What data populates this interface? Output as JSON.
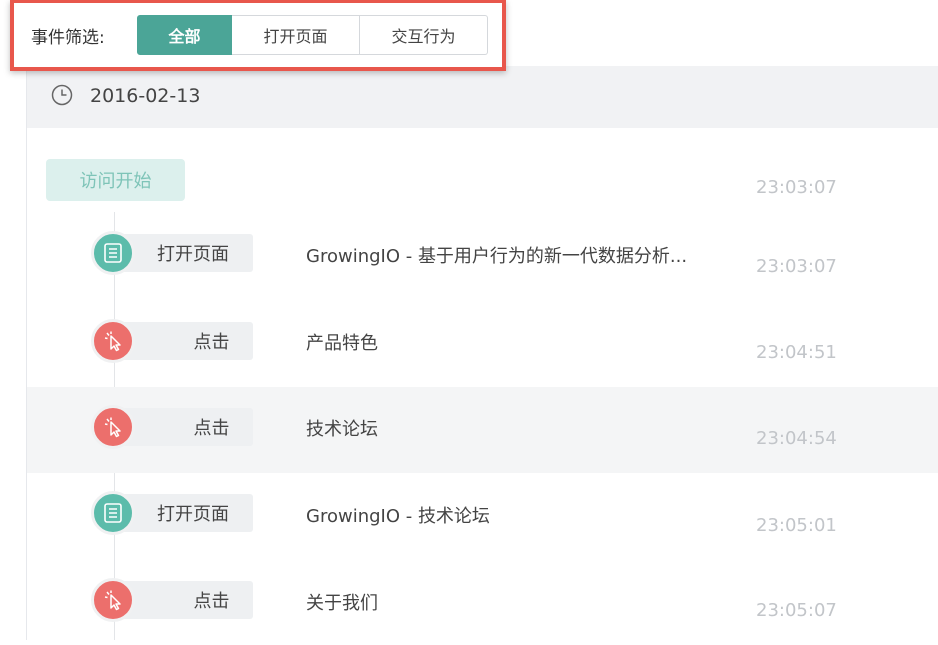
{
  "filter": {
    "label": "事件筛选:",
    "options": [
      "全部",
      "打开页面",
      "交互行为"
    ],
    "active_index": 0
  },
  "date": "2016-02-13",
  "session_start": {
    "label": "访问开始",
    "time": "23:03:07"
  },
  "events": [
    {
      "type": "page",
      "tag": "打开页面",
      "desc": "GrowingIO - 基于用户行为的新一代数据分析...",
      "time": "23:03:07"
    },
    {
      "type": "click",
      "tag": "点击",
      "desc": "产品特色",
      "time": "23:04:51"
    },
    {
      "type": "click",
      "tag": "点击",
      "desc": "技术论坛",
      "time": "23:04:54"
    },
    {
      "type": "page",
      "tag": "打开页面",
      "desc": "GrowingIO - 技术论坛",
      "time": "23:05:01"
    },
    {
      "type": "click",
      "tag": "点击",
      "desc": "关于我们",
      "time": "23:05:07"
    }
  ],
  "colors": {
    "accent": "#4ba597",
    "page_icon": "#5cbcab",
    "click_icon": "#ec6f6c",
    "highlight_border": "#e8574c"
  },
  "icons": {
    "page": "page-list-icon",
    "click": "cursor-click-icon",
    "date": "clock-icon"
  }
}
